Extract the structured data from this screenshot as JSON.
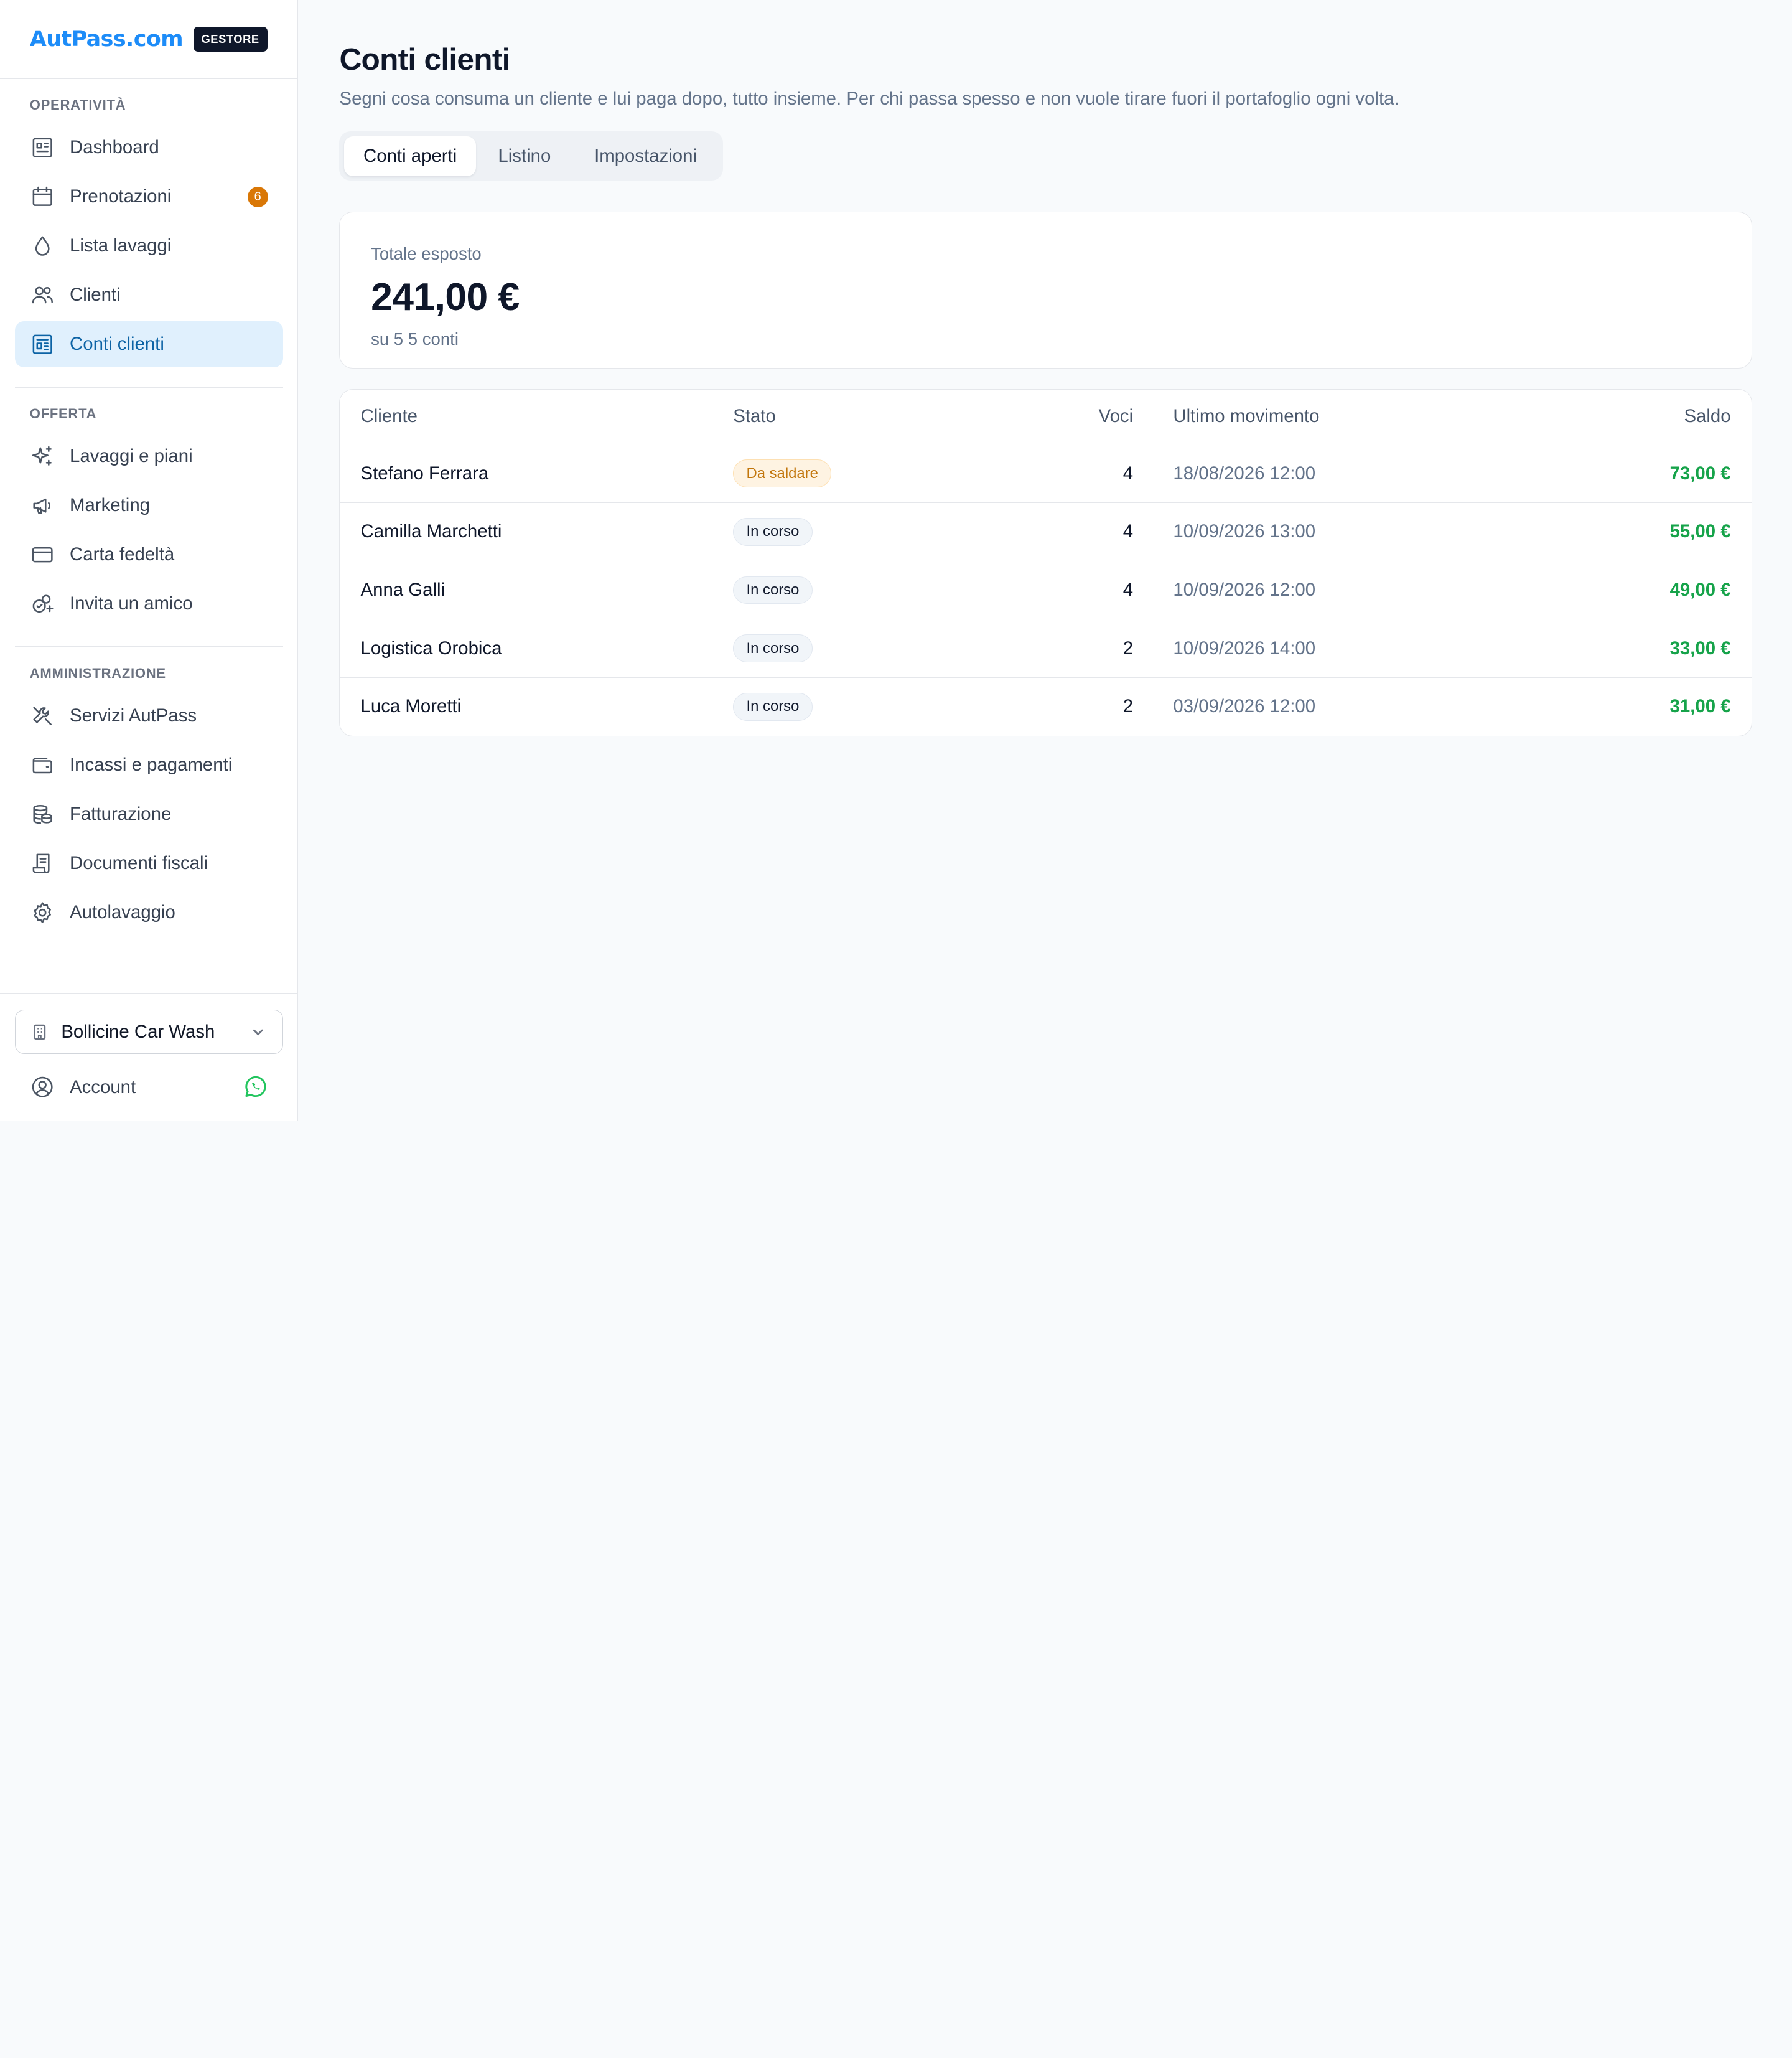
{
  "brand": {
    "logo": "AutPass.com",
    "badge": "GESTORE"
  },
  "sidebar": {
    "sections": [
      {
        "title": "OPERATIVITÀ",
        "items": [
          {
            "label": "Dashboard",
            "icon": "dashboard-icon"
          },
          {
            "label": "Prenotazioni",
            "icon": "calendar-icon",
            "badge": "6"
          },
          {
            "label": "Lista lavaggi",
            "icon": "droplet-icon"
          },
          {
            "label": "Clienti",
            "icon": "users-icon"
          },
          {
            "label": "Conti clienti",
            "icon": "ledger-icon",
            "active": true
          }
        ]
      },
      {
        "title": "OFFERTA",
        "items": [
          {
            "label": "Lavaggi e piani",
            "icon": "sparkles-icon"
          },
          {
            "label": "Marketing",
            "icon": "megaphone-icon"
          },
          {
            "label": "Carta fedeltà",
            "icon": "card-icon"
          },
          {
            "label": "Invita un amico",
            "icon": "invite-icon"
          }
        ]
      },
      {
        "title": "AMMINISTRAZIONE",
        "items": [
          {
            "label": "Servizi AutPass",
            "icon": "tools-icon"
          },
          {
            "label": "Incassi e pagamenti",
            "icon": "wallet-icon"
          },
          {
            "label": "Fatturazione",
            "icon": "coins-icon"
          },
          {
            "label": "Documenti fiscali",
            "icon": "receipt-icon"
          },
          {
            "label": "Autolavaggio",
            "icon": "gear-icon"
          }
        ]
      }
    ],
    "location": "Bollicine Car Wash",
    "account": "Account"
  },
  "main": {
    "title": "Conti clienti",
    "subtitle": "Segni cosa consuma un cliente e lui paga dopo, tutto insieme. Per chi passa spesso e non vuole tirare fuori il portafoglio ogni volta.",
    "tabs": [
      "Conti aperti",
      "Listino",
      "Impostazioni"
    ],
    "summary": {
      "label": "Totale esposto",
      "value": "241,00 €",
      "note": "su 5 5 conti"
    },
    "table": {
      "headers": {
        "cliente": "Cliente",
        "stato": "Stato",
        "voci": "Voci",
        "ultimo": "Ultimo movimento",
        "saldo": "Saldo"
      },
      "rows": [
        {
          "cliente": "Stefano Ferrara",
          "stato": "Da saldare",
          "warn": true,
          "voci": "4",
          "ultimo": "18/08/2026 12:00",
          "saldo": "73,00 €"
        },
        {
          "cliente": "Camilla Marchetti",
          "stato": "In corso",
          "voci": "4",
          "ultimo": "10/09/2026 13:00",
          "saldo": "55,00 €"
        },
        {
          "cliente": "Anna Galli",
          "stato": "In corso",
          "voci": "4",
          "ultimo": "10/09/2026 12:00",
          "saldo": "49,00 €"
        },
        {
          "cliente": "Logistica Orobica",
          "stato": "In corso",
          "voci": "2",
          "ultimo": "10/09/2026 14:00",
          "saldo": "33,00 €"
        },
        {
          "cliente": "Luca Moretti",
          "stato": "In corso",
          "voci": "2",
          "ultimo": "03/09/2026 12:00",
          "saldo": "31,00 €"
        }
      ]
    }
  },
  "colors": {
    "accent": "#1d8cf8",
    "active_bg": "#e0f0fd",
    "active_text": "#0c63a5",
    "positive": "#16a34a",
    "warning": "#d97706"
  }
}
